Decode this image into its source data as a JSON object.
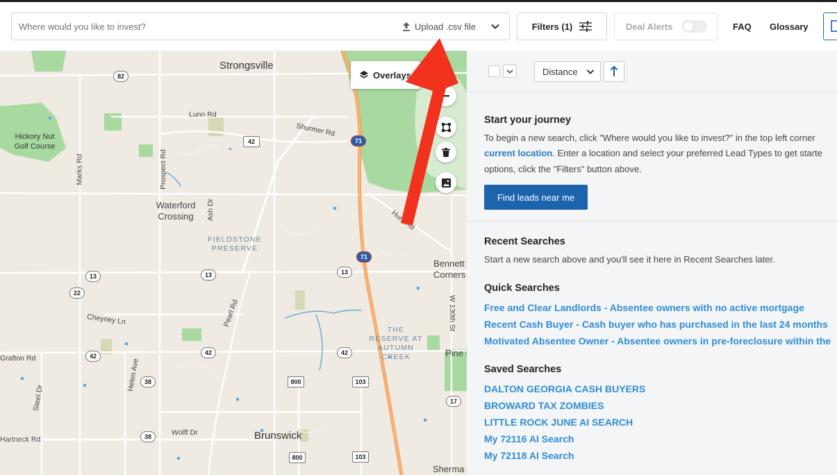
{
  "topbar": {
    "search_placeholder": "Where would you like to invest?",
    "upload_label": "Upload .csv file",
    "filters_label": "Filters (1)",
    "deal_alerts_label": "Deal Alerts",
    "deal_alerts_on": false,
    "faq_label": "FAQ",
    "glossary_label": "Glossary"
  },
  "map": {
    "overlays_label": "Overlays",
    "tools": [
      "minus-icon",
      "polygon-draw-icon",
      "trash-icon",
      "image-icon"
    ],
    "cities": [
      "Strongsville",
      "Brunswick"
    ],
    "places": [
      "Waterford Crossing",
      "Bennett Corners",
      "Pine H",
      "Sherma"
    ],
    "golf": "Hickory Nut Golf Course",
    "parks": [
      "FIELDSTONE PRESERVE",
      "THE RESERVE AT AUTUMN CREEK"
    ],
    "streets": [
      "Lunn Rd",
      "Shurmer Rd",
      "Marks Rd",
      "Prospect Rd",
      "Ash Dr",
      "Hunt Rd",
      "Pearl Rd",
      "Cheyney Ln",
      "Grafton Rd",
      "Helen Ave",
      "Steel Dr",
      "Wolff Dr",
      "Hartneck Rd",
      "W 130th St"
    ],
    "route_shields": [
      "82",
      "42",
      "71",
      "71",
      "13",
      "13",
      "13",
      "22",
      "42",
      "42",
      "42",
      "38",
      "800",
      "103",
      "17",
      "38",
      "800",
      "103"
    ]
  },
  "results": {
    "sort_label": "Distance",
    "journey_title": "Start your journey",
    "journey_line1": "To begin a new search, click \"Where would you like to invest?\" in the top left corner",
    "journey_link": "current location",
    "journey_line2_rest": ". Enter a location and select your preferred Lead Types to get starte",
    "journey_line3": "options, click the \"Filters\" button above.",
    "find_button": "Find leads near me",
    "recent_title": "Recent Searches",
    "recent_text": "Start a new search above and you'll see it here in Recent Searches later.",
    "quick_title": "Quick Searches",
    "quick_searches": [
      "Free and Clear Landlords - Absentee owners with no active mortgage",
      "Recent Cash Buyer - Cash buyer who has purchased in the last 24 months",
      "Motivated Absentee Owner - Absentee owners in pre-foreclosure within the"
    ],
    "saved_title": "Saved Searches",
    "saved_searches": [
      "DALTON GEORGIA CASH BUYERS",
      "BROWARD TAX ZOMBIES",
      "LITTLE ROCK JUNE AI SEARCH",
      "My 72116 AI Search",
      "My 72118 AI Search"
    ]
  },
  "colors": {
    "primary": "#1d64ae",
    "link": "#2f8dd6",
    "annotation_arrow": "#f0321e",
    "highway": "#f5a25d",
    "park_green": "#a8d9a0"
  }
}
